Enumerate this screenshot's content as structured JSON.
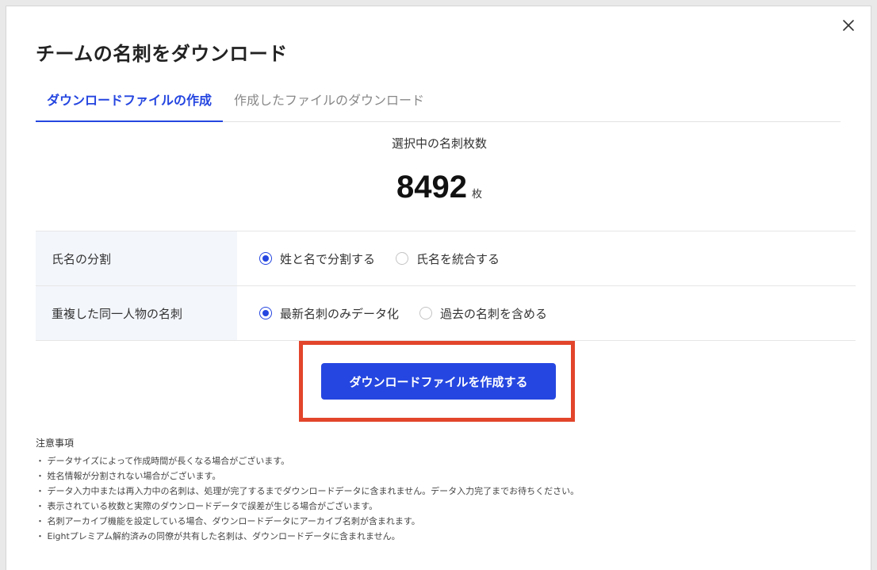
{
  "dialog": {
    "title": "チームの名刺をダウンロード",
    "close_label": "×"
  },
  "tabs": [
    {
      "label": "ダウンロードファイルの作成",
      "active": true
    },
    {
      "label": "作成したファイルのダウンロード",
      "active": false
    }
  ],
  "count": {
    "label": "選択中の名刺枚数",
    "value": "8492",
    "unit": "枚"
  },
  "options": [
    {
      "label": "氏名の分割",
      "choices": [
        {
          "label": "姓と名で分割する",
          "selected": true
        },
        {
          "label": "氏名を統合する",
          "selected": false
        }
      ]
    },
    {
      "label": "重複した同一人物の名刺",
      "choices": [
        {
          "label": "最新名刺のみデータ化",
          "selected": true
        },
        {
          "label": "過去の名刺を含める",
          "selected": false
        }
      ]
    }
  ],
  "create_button": {
    "label": "ダウンロードファイルを作成する"
  },
  "notes": {
    "title": "注意事項",
    "items": [
      "・ データサイズによって作成時間が長くなる場合がございます。",
      "・ 姓名情報が分割されない場合がございます。",
      "・ データ入力中または再入力中の名刺は、処理が完了するまでダウンロードデータに含まれません。データ入力完了までお待ちください。",
      "・ 表示されている枚数と実際のダウンロードデータで誤差が生じる場合がございます。",
      "・ 名刺アーカイブ機能を設定している場合、ダウンロードデータにアーカイブ名刺が含まれます。",
      "・ Eightプレミアム解約済みの同僚が共有した名刺は、ダウンロードデータに含まれません。"
    ]
  },
  "colors": {
    "accent": "#2546e0",
    "highlight": "#e2452b"
  }
}
